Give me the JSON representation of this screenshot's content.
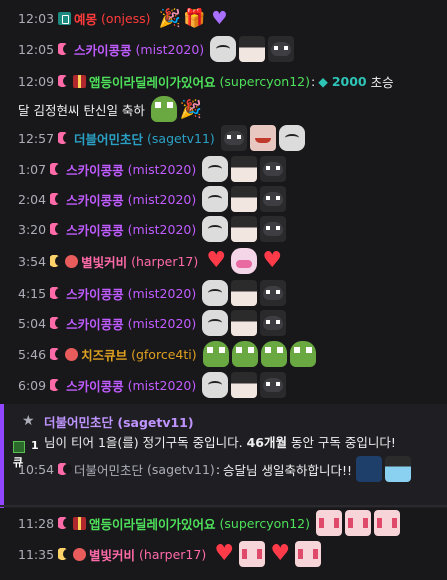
{
  "messages": [
    {
      "time": "12:03",
      "badges": [
        "mod"
      ],
      "name": "예몽",
      "login": "(onjess)",
      "nameColor": "#ff3b3b",
      "emotes": [
        "party-hat-icon",
        "gift-box-icon",
        "purple-heart-icon"
      ],
      "text": ""
    },
    {
      "time": "12:05",
      "badges": [
        "moon"
      ],
      "name": "스카이콩콩",
      "login": "(mist2020)",
      "nameColor": "#c05cff",
      "emotes": [
        "bunny",
        "girl",
        "cat"
      ],
      "text": ""
    },
    {
      "time": "12:09",
      "badges": [
        "moon",
        "gift"
      ],
      "name": "앱등이라딜레이가있어요",
      "login": "(supercyon12)",
      "nameColor": "#4ee05a",
      "bits": "2000",
      "text1": "초승",
      "text2": "달 김정현씨 탄신일 축하"
    },
    {
      "time": "12:57",
      "badges": [
        "moon"
      ],
      "name": "더블어민초단",
      "login": "(sagetv11)",
      "nameColor": "#2aa1c4",
      "emotes": [
        "cat",
        "face",
        "bunny"
      ],
      "text": ""
    },
    {
      "time": "1:07",
      "badges": [
        "moon"
      ],
      "name": "스카이콩콩",
      "login": "(mist2020)",
      "nameColor": "#c05cff",
      "emotes": [
        "bunny",
        "girl",
        "cat"
      ]
    },
    {
      "time": "2:04",
      "badges": [
        "moon"
      ],
      "name": "스카이콩콩",
      "login": "(mist2020)",
      "nameColor": "#c05cff",
      "emotes": [
        "bunny",
        "girl",
        "cat"
      ]
    },
    {
      "time": "3:20",
      "badges": [
        "moon"
      ],
      "name": "스카이콩콩",
      "login": "(mist2020)",
      "nameColor": "#c05cff",
      "emotes": [
        "bunny",
        "girl",
        "cat"
      ]
    },
    {
      "time": "3:54",
      "badges": [
        "moon-y",
        "rec"
      ],
      "name": "별빛커비",
      "login": "(harper17)",
      "nameColor": "#ff6aa8",
      "emotes": [
        "heart",
        "cake",
        "heart"
      ]
    },
    {
      "time": "4:15",
      "badges": [
        "moon"
      ],
      "name": "스카이콩콩",
      "login": "(mist2020)",
      "nameColor": "#c05cff",
      "emotes": [
        "bunny",
        "girl",
        "cat"
      ]
    },
    {
      "time": "5:04",
      "badges": [
        "moon"
      ],
      "name": "스카이콩콩",
      "login": "(mist2020)",
      "nameColor": "#c05cff",
      "emotes": [
        "bunny",
        "girl",
        "cat"
      ]
    },
    {
      "time": "5:46",
      "badges": [
        "moon",
        "rec"
      ],
      "name": "치즈큐브",
      "login": "(gforce4ti)",
      "nameColor": "#e0a020",
      "emotes": [
        "pepe",
        "pepe",
        "pepe",
        "pepe"
      ]
    },
    {
      "time": "6:09",
      "badges": [
        "moon"
      ],
      "name": "스카이콩콩",
      "login": "(mist2020)",
      "nameColor": "#c05cff",
      "emotes": [
        "bunny",
        "girl",
        "cat"
      ]
    }
  ],
  "sub_notice": {
    "name": "더불어민초단 (sagetv11)",
    "text_pre": "님이 티어 1을(를) 정기구독 중입니다. ",
    "months": "46개월",
    "text_post": " 동안 구독 중입니다!",
    "time": "10:54",
    "chat_name": "더불어민초단",
    "chat_login": "(sagetv11)",
    "chat_text": "승달님 생일축하합니다!!"
  },
  "side_effect": {
    "count": "1",
    "label": "큐"
  },
  "after": [
    {
      "time": "11:28",
      "name": "앱등이라딜레이가있어요",
      "login": "(supercyon12)",
      "nameColor": "#4ee05a"
    },
    {
      "time": "11:35",
      "name": "별빛커비",
      "login": "(harper17)",
      "nameColor": "#ff6aa8"
    }
  ],
  "colors": {
    "background": "#18181b",
    "timestamp": "#adadb8",
    "sub_accent": "#9147ff"
  }
}
